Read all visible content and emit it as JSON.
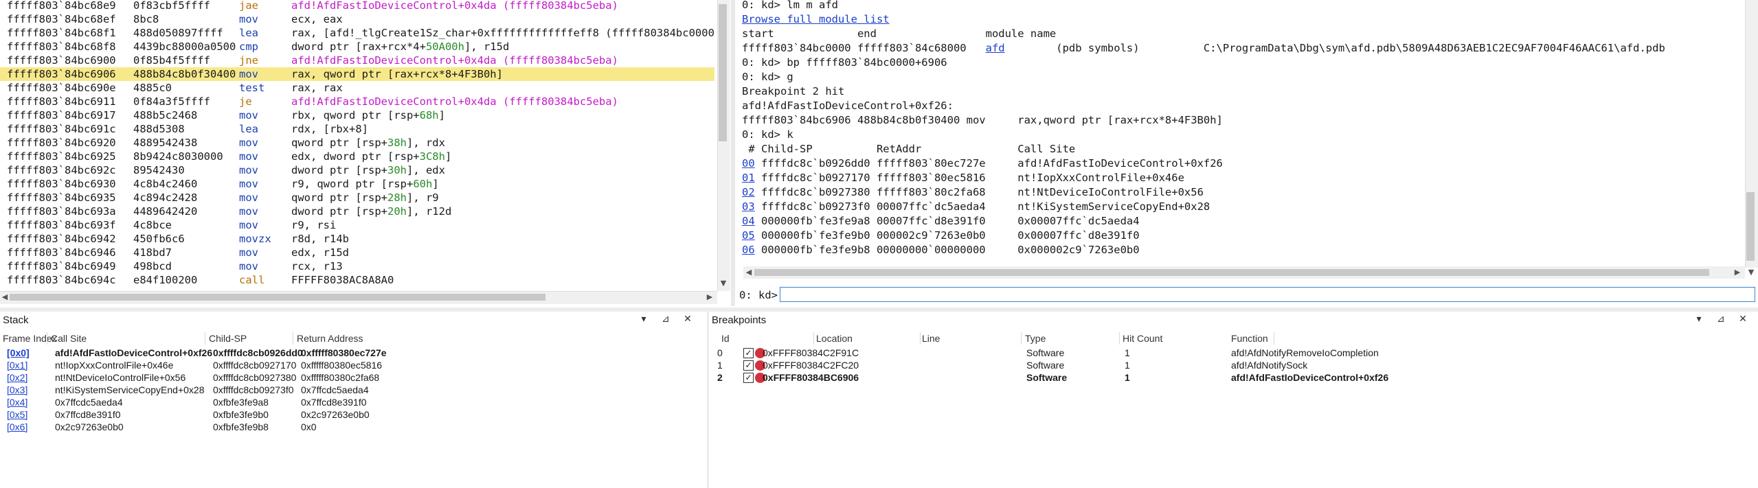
{
  "disassembly": [
    {
      "addr": "fffff803`84bc68e9",
      "bytes": "0f83cbf5ffff",
      "mn": "jae",
      "ops": [
        {
          "t": "afd!AfdFastIoDeviceControl+0x4da (fffff80384bc5eba)",
          "k": "jump"
        }
      ],
      "kind": "jump"
    },
    {
      "addr": "fffff803`84bc68ef",
      "bytes": "8bc8",
      "mn": "mov",
      "ops": [
        {
          "t": "ecx, eax"
        }
      ],
      "kind": "normal"
    },
    {
      "addr": "fffff803`84bc68f1",
      "bytes": "488d050897ffff",
      "mn": "lea",
      "ops": [
        {
          "t": "rax, [afd!_tlgCreate1Sz_char+0xfffffffffffffeff8 (fffff80384bc0000"
        }
      ],
      "kind": "normal"
    },
    {
      "addr": "fffff803`84bc68f8",
      "bytes": "4439bc88000a0500",
      "mn": "cmp",
      "ops": [
        {
          "t": "dword ptr [rax+rcx*4+"
        },
        {
          "t": "50A00h",
          "k": "num"
        },
        {
          "t": "], r15d"
        }
      ],
      "kind": "normal"
    },
    {
      "addr": "fffff803`84bc6900",
      "bytes": "0f85b4f5ffff",
      "mn": "jne",
      "ops": [
        {
          "t": "afd!AfdFastIoDeviceControl+0x4da (fffff80384bc5eba)",
          "k": "jump"
        }
      ],
      "kind": "jump"
    },
    {
      "addr": "fffff803`84bc6906",
      "bytes": "488b84c8b0f30400",
      "mn": "mov",
      "ops": [
        {
          "t": "rax, qword ptr [rax+rcx*8+4F3B0h]"
        }
      ],
      "kind": "normal",
      "highlight": true
    },
    {
      "addr": "fffff803`84bc690e",
      "bytes": "4885c0",
      "mn": "test",
      "ops": [
        {
          "t": "rax, rax"
        }
      ],
      "kind": "normal"
    },
    {
      "addr": "fffff803`84bc6911",
      "bytes": "0f84a3f5ffff",
      "mn": "je",
      "ops": [
        {
          "t": "afd!AfdFastIoDeviceControl+0x4da (fffff80384bc5eba)",
          "k": "jump"
        }
      ],
      "kind": "jump"
    },
    {
      "addr": "fffff803`84bc6917",
      "bytes": "488b5c2468",
      "mn": "mov",
      "ops": [
        {
          "t": "rbx, qword ptr [rsp+"
        },
        {
          "t": "68h",
          "k": "num"
        },
        {
          "t": "]"
        }
      ],
      "kind": "normal"
    },
    {
      "addr": "fffff803`84bc691c",
      "bytes": "488d5308",
      "mn": "lea",
      "ops": [
        {
          "t": "rdx, [rbx+8]"
        }
      ],
      "kind": "normal"
    },
    {
      "addr": "fffff803`84bc6920",
      "bytes": "4889542438",
      "mn": "mov",
      "ops": [
        {
          "t": "qword ptr [rsp+"
        },
        {
          "t": "38h",
          "k": "num"
        },
        {
          "t": "], rdx"
        }
      ],
      "kind": "normal"
    },
    {
      "addr": "fffff803`84bc6925",
      "bytes": "8b9424c8030000",
      "mn": "mov",
      "ops": [
        {
          "t": "edx, dword ptr [rsp+"
        },
        {
          "t": "3C8h",
          "k": "num"
        },
        {
          "t": "]"
        }
      ],
      "kind": "normal"
    },
    {
      "addr": "fffff803`84bc692c",
      "bytes": "89542430",
      "mn": "mov",
      "ops": [
        {
          "t": "dword ptr [rsp+"
        },
        {
          "t": "30h",
          "k": "num"
        },
        {
          "t": "], edx"
        }
      ],
      "kind": "normal"
    },
    {
      "addr": "fffff803`84bc6930",
      "bytes": "4c8b4c2460",
      "mn": "mov",
      "ops": [
        {
          "t": "r9, qword ptr [rsp+"
        },
        {
          "t": "60h",
          "k": "num"
        },
        {
          "t": "]"
        }
      ],
      "kind": "normal"
    },
    {
      "addr": "fffff803`84bc6935",
      "bytes": "4c894c2428",
      "mn": "mov",
      "ops": [
        {
          "t": "qword ptr [rsp+"
        },
        {
          "t": "28h",
          "k": "num"
        },
        {
          "t": "], r9"
        }
      ],
      "kind": "normal"
    },
    {
      "addr": "fffff803`84bc693a",
      "bytes": "4489642420",
      "mn": "mov",
      "ops": [
        {
          "t": "dword ptr [rsp+"
        },
        {
          "t": "20h",
          "k": "num"
        },
        {
          "t": "], r12d"
        }
      ],
      "kind": "normal"
    },
    {
      "addr": "fffff803`84bc693f",
      "bytes": "4c8bce",
      "mn": "mov",
      "ops": [
        {
          "t": "r9, rsi"
        }
      ],
      "kind": "normal"
    },
    {
      "addr": "fffff803`84bc6942",
      "bytes": "450fb6c6",
      "mn": "movzx",
      "ops": [
        {
          "t": "r8d, r14b"
        }
      ],
      "kind": "normal"
    },
    {
      "addr": "fffff803`84bc6946",
      "bytes": "418bd7",
      "mn": "mov",
      "ops": [
        {
          "t": "edx, r15d"
        }
      ],
      "kind": "normal"
    },
    {
      "addr": "fffff803`84bc6949",
      "bytes": "498bcd",
      "mn": "mov",
      "ops": [
        {
          "t": "rcx, r13"
        }
      ],
      "kind": "normal"
    },
    {
      "addr": "fffff803`84bc694c",
      "bytes": "e84f100200",
      "mn": "call",
      "ops": [
        {
          "t": "FFFFF8038AC8A8A0"
        }
      ],
      "kind": "jump"
    }
  ],
  "command": {
    "lines": [
      [
        {
          "t": "0: kd> lm m afd"
        }
      ],
      [
        {
          "t": "Browse full module list",
          "link": true
        }
      ],
      [
        {
          "t": "start             end                 module name"
        }
      ],
      [
        {
          "t": "fffff803`84bc0000 fffff803`84c68000   "
        },
        {
          "t": "afd",
          "link": true
        },
        {
          "t": "        (pdb symbols)          C:\\ProgramData\\Dbg\\sym\\afd.pdb\\5809A48D63AEB1C2EC9AF7004F46AAC61\\afd.pdb"
        }
      ],
      [
        {
          "t": "0: kd> bp fffff803`84bc0000+6906"
        }
      ],
      [
        {
          "t": "0: kd> g"
        }
      ],
      [
        {
          "t": "Breakpoint 2 hit"
        }
      ],
      [
        {
          "t": "afd!AfdFastIoDeviceControl+0xf26:"
        }
      ],
      [
        {
          "t": "fffff803`84bc6906 488b84c8b0f30400 mov     rax,qword ptr [rax+rcx*8+4F3B0h]"
        }
      ],
      [
        {
          "t": "0: kd> k"
        }
      ],
      [
        {
          "t": " # Child-SP          RetAddr               Call Site"
        }
      ],
      [
        {
          "t": "00",
          "link": true
        },
        {
          "t": " ffffdc8c`b0926dd0 fffff803`80ec727e     afd!AfdFastIoDeviceControl+0xf26"
        }
      ],
      [
        {
          "t": "01",
          "link": true
        },
        {
          "t": " ffffdc8c`b0927170 fffff803`80ec5816     nt!IopXxxControlFile+0x46e"
        }
      ],
      [
        {
          "t": "02",
          "link": true
        },
        {
          "t": " ffffdc8c`b0927380 fffff803`80c2fa68     nt!NtDeviceIoControlFile+0x56"
        }
      ],
      [
        {
          "t": "03",
          "link": true
        },
        {
          "t": " ffffdc8c`b09273f0 00007ffc`dc5aeda4     nt!KiSystemServiceCopyEnd+0x28"
        }
      ],
      [
        {
          "t": "04",
          "link": true
        },
        {
          "t": " 000000fb`fe3fe9a8 00007ffc`d8e391f0     0x00007ffc`dc5aeda4"
        }
      ],
      [
        {
          "t": "05",
          "link": true
        },
        {
          "t": " 000000fb`fe3fe9b0 000002c9`7263e0b0     0x00007ffc`d8e391f0"
        }
      ],
      [
        {
          "t": "06",
          "link": true
        },
        {
          "t": " 000000fb`fe3fe9b8 00000000`00000000     0x000002c9`7263e0b0"
        }
      ]
    ],
    "prompt": "0: kd>",
    "input_value": ""
  },
  "stack_panel": {
    "title": "Stack",
    "columns": [
      "Frame Index",
      "Call Site",
      "Child-SP",
      "Return Address"
    ],
    "rows": [
      {
        "index": "[0x0]",
        "call_site": "afd!AfdFastIoDeviceControl+0xf26",
        "child_sp": "0xffffdc8cb0926dd0",
        "ret": "0xfffff80380ec727e",
        "bold": true
      },
      {
        "index": "[0x1]",
        "call_site": "nt!IopXxxControlFile+0x46e",
        "child_sp": "0xffffdc8cb0927170",
        "ret": "0xfffff80380ec5816"
      },
      {
        "index": "[0x2]",
        "call_site": "nt!NtDeviceIoControlFile+0x56",
        "child_sp": "0xffffdc8cb0927380",
        "ret": "0xfffff80380c2fa68"
      },
      {
        "index": "[0x3]",
        "call_site": "nt!KiSystemServiceCopyEnd+0x28",
        "child_sp": "0xffffdc8cb09273f0",
        "ret": "0x7ffcdc5aeda4"
      },
      {
        "index": "[0x4]",
        "call_site": "0x7ffcdc5aeda4",
        "child_sp": "0xfbfe3fe9a8",
        "ret": "0x7ffcd8e391f0"
      },
      {
        "index": "[0x5]",
        "call_site": "0x7ffcd8e391f0",
        "child_sp": "0xfbfe3fe9b0",
        "ret": "0x2c97263e0b0"
      },
      {
        "index": "[0x6]",
        "call_site": "0x2c97263e0b0",
        "child_sp": "0xfbfe3fe9b8",
        "ret": "0x0"
      }
    ]
  },
  "bp_panel": {
    "title": "Breakpoints",
    "columns": [
      "Id",
      "Location",
      "Line",
      "Type",
      "Hit Count",
      "Function"
    ],
    "rows": [
      {
        "id": "0",
        "location": "0xFFFF80384C2F91C",
        "line": "",
        "type": "Software",
        "hits": "1",
        "function": "afd!AfdNotifyRemoveIoCompletion",
        "checked": true
      },
      {
        "id": "1",
        "location": "0xFFFF80384C2FC20",
        "line": "",
        "type": "Software",
        "hits": "1",
        "function": "afd!AfdNotifySock",
        "checked": true
      },
      {
        "id": "2",
        "location": "0xFFFF80384BC6906",
        "line": "",
        "type": "Software",
        "hits": "1",
        "function": "afd!AfdFastIoDeviceControl+0xf26",
        "checked": true,
        "bold": true
      }
    ]
  },
  "icons": {
    "dropdown": "chevron-down-icon",
    "pin": "pin-icon",
    "close": "close-icon",
    "up": "scroll-up-icon",
    "down": "scroll-down-icon",
    "left": "scroll-left-icon",
    "right": "scroll-right-icon",
    "breakpoint": "breakpoint-dot-icon",
    "check": "checkbox-icon"
  },
  "colors": {
    "highlight": "#f7e98a",
    "jump_mnemonic": "#b8700a",
    "jump_target": "#c21cc8",
    "mnemonic": "#1a3fb0",
    "number": "#2a8a2a",
    "link": "#1a3fcc",
    "breakpoint": "#d3313d"
  }
}
